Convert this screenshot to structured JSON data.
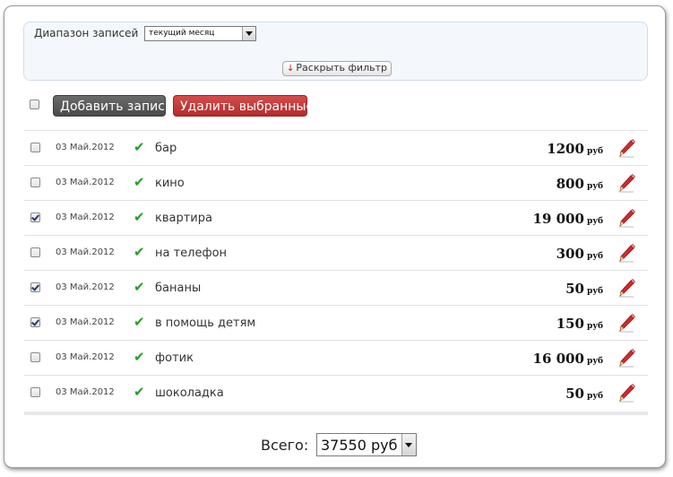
{
  "filter": {
    "range_label": "Диапазон записей",
    "range_value": "текущий месяц",
    "expand_label": "Раскрыть фильтр"
  },
  "toolbar": {
    "add_label": "Добавить запись",
    "delete_label": "Удалить выбранные"
  },
  "entries": [
    {
      "checked": false,
      "date": "03 Май.2012",
      "name": "бар",
      "amount": "1200",
      "currency": "руб"
    },
    {
      "checked": false,
      "date": "03 Май.2012",
      "name": "кино",
      "amount": "800",
      "currency": "руб"
    },
    {
      "checked": true,
      "date": "03 Май.2012",
      "name": "квартира",
      "amount": "19 000",
      "currency": "руб"
    },
    {
      "checked": false,
      "date": "03 Май.2012",
      "name": "на телефон",
      "amount": "300",
      "currency": "руб"
    },
    {
      "checked": true,
      "date": "03 Май.2012",
      "name": "бананы",
      "amount": "50",
      "currency": "руб"
    },
    {
      "checked": true,
      "date": "03 Май.2012",
      "name": "в помощь детям",
      "amount": "150",
      "currency": "руб"
    },
    {
      "checked": false,
      "date": "03 Май.2012",
      "name": "фотик",
      "amount": "16 000",
      "currency": "руб"
    },
    {
      "checked": false,
      "date": "03 Май.2012",
      "name": "шоколадка",
      "amount": "50",
      "currency": "руб"
    }
  ],
  "total": {
    "label": "Всего:",
    "value": "37550 руб"
  },
  "icons": {
    "confirmed": "check-icon",
    "edit": "pencil-icon",
    "expand": "arrow-down-icon"
  },
  "colors": {
    "add_button": "#555555",
    "delete_button": "#c03a3a",
    "check": "#22a022",
    "pencil": "#d52a2a"
  }
}
